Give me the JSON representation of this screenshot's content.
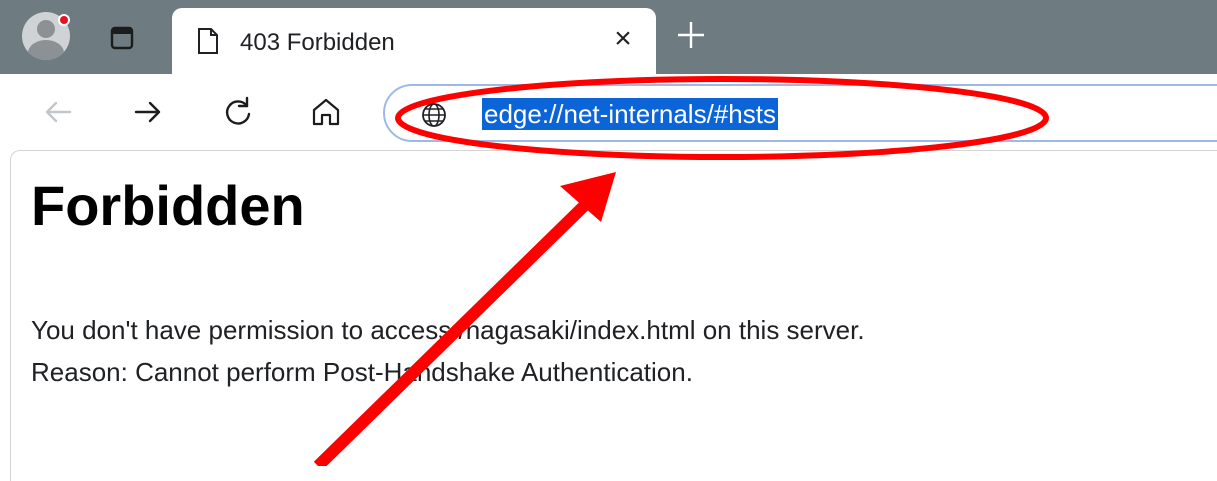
{
  "browser": {
    "tab": {
      "title": "403 Forbidden",
      "close_glyph": "×"
    },
    "new_tab_icon": "plus-icon",
    "address_bar": {
      "url": "edge://net-internals/#hsts",
      "icon": "globe-icon"
    },
    "nav": {
      "back_icon": "back-arrow-icon",
      "forward_icon": "forward-arrow-icon",
      "refresh_icon": "refresh-icon",
      "home_icon": "home-icon"
    }
  },
  "page": {
    "title": "Forbidden",
    "message_line_1": "You don't have permission to access /nagasaki/index.html on this server.",
    "message_line_2": "Reason: Cannot perform Post-Handshake Authentication."
  },
  "annotation": {
    "color": "#ff0000",
    "shapes": [
      "ellipse",
      "arrow"
    ]
  },
  "colors": {
    "tabbar": "#6e7b80",
    "selection": "#0b64d8",
    "address_border": "#9fb9e6"
  }
}
